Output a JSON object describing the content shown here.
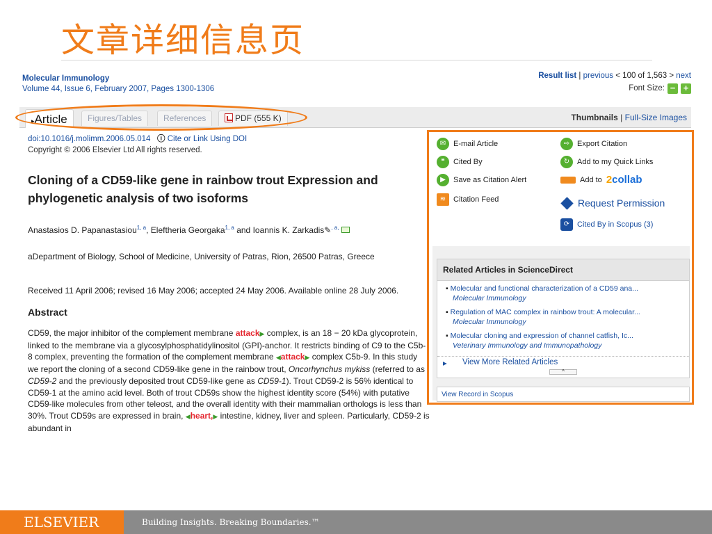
{
  "slide_title": "文章详细信息页",
  "journal": {
    "name": "Molecular Immunology",
    "issue": "Volume 44, Issue 6, February 2007, Pages 1300-1306"
  },
  "nav": {
    "result_list": "Result list",
    "previous": "previous",
    "position": "< 100 of 1,563 >",
    "next": "next",
    "font_size": "Font Size:",
    "minus": "−",
    "plus": "+"
  },
  "tabs": {
    "article": "Article",
    "figures": "Figures/Tables",
    "references": "References",
    "pdf": "PDF (555 K)"
  },
  "thumbs": {
    "thumbnails": "Thumbnails",
    "full_size": "Full-Size Images"
  },
  "article": {
    "doi": "doi:10.1016/j.molimm.2006.05.014",
    "cite": "Cite or Link Using DOI",
    "copyright": "Copyright © 2006 Elsevier Ltd All rights reserved.",
    "title": "Cloning of a CD59-like gene in rainbow trout Expression and phylogenetic analysis of two isoforms",
    "author1": "Anastasios D. Papanastasiou",
    "author2": "Eleftheria Georgaka",
    "author3": "Ioannis K. Zarkadis",
    "sup": "1, a",
    "sup_last": ", a,",
    "affiliation": "aDepartment of Biology, School of Medicine, University of Patras, Rion, 26500 Patras, Greece",
    "dates": "Received 11 April 2006;  revised 16 May 2006;  accepted 24 May 2006.  Available online 28 July 2006.",
    "abstract_heading": "Abstract",
    "abstract": {
      "p1": "CD59, the major inhibitor of the complement membrane ",
      "kw1": "attack",
      "p2": " complex, is an 18 − 20 kDa glycoprotein, linked to the membrane via a glycosylphosphatidylinositol (GPI)-anchor. It restricts binding of C9 to the C5b-8 complex, preventing the formation of the complement membrane ",
      "kw2": "attack",
      "p3": " complex C5b-9. In this study we report the cloning of a second CD59-like gene in the rainbow trout, ",
      "species": "Oncorhynchus mykiss",
      "p4": " (referred to as ",
      "cd592": "CD59-2",
      "p5": " and the previously deposited trout CD59-like gene as ",
      "cd591": "CD59-1",
      "p6": "). Trout CD59-2 is 56% identical to CD59-1 at the amino acid level. Both of trout CD59s show the highest identity score (54%) with putative CD59-like molecules from other teleost, and the overall identity with their mammalian orthologs is less than 30%. Trout CD59s are expressed in brain, ",
      "kw3": "heart,",
      "p7": " intestine, kidney, liver and spleen. Particularly, CD59-2 is abundant in"
    }
  },
  "actions": {
    "email": "E-mail Article",
    "export": "Export Citation",
    "cited_by": "Cited By",
    "quick_links": "Add to my Quick Links",
    "save_alert": "Save as Citation Alert",
    "add_to": "Add to",
    "collab_a": "2",
    "collab_b": "collab",
    "feed": "Citation Feed",
    "permission": "Request Permission",
    "scopus_cited": "Cited By in Scopus (3)"
  },
  "related": {
    "heading": "Related Articles in ScienceDirect",
    "items": [
      {
        "title": "Molecular and functional characterization of a CD59 ana...",
        "journal": "Molecular Immunology"
      },
      {
        "title": "Regulation of MAC complex in rainbow trout: A molecular...",
        "journal": "Molecular Immunology"
      },
      {
        "title": "Molecular cloning and expression of channel catfish, Ic...",
        "journal": "Veterinary Immunology and Immunopathology"
      }
    ],
    "more": "View More Related Articles",
    "collapse": "^"
  },
  "scopus_record": "View Record in Scopus",
  "footer": {
    "brand": "ELSEVIER",
    "tagline": "Building Insights. Breaking Boundaries.™"
  },
  "colors": {
    "accent": "#f07c1a",
    "link": "#1a4fa0",
    "keyword": "#e4262f",
    "icon_green": "#55b030"
  }
}
